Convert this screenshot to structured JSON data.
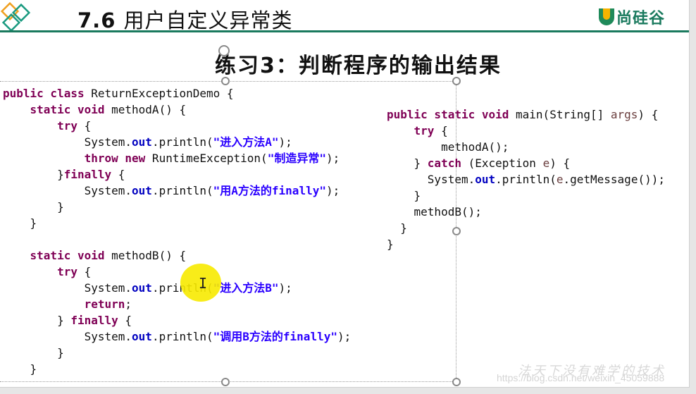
{
  "header": {
    "title_number": "7.6",
    "title_text": "用户自定义异常类",
    "brand": "尚硅谷",
    "accent_color": "#1a7a5e"
  },
  "subtitle": "练习3：判断程序的输出结果",
  "left_code": [
    [
      {
        "t": "public class",
        "c": "kw"
      },
      {
        "t": " ReturnExceptionDemo {",
        "c": ""
      }
    ],
    [
      {
        "t": "    ",
        "c": ""
      },
      {
        "t": "static void",
        "c": "kw"
      },
      {
        "t": " methodA() {",
        "c": ""
      }
    ],
    [
      {
        "t": "        ",
        "c": ""
      },
      {
        "t": "try",
        "c": "kw"
      },
      {
        "t": " {",
        "c": ""
      }
    ],
    [
      {
        "t": "            System.",
        "c": ""
      },
      {
        "t": "out",
        "c": "fld"
      },
      {
        "t": ".println(",
        "c": ""
      },
      {
        "t": "\"进入方法A\"",
        "c": "str"
      },
      {
        "t": ");",
        "c": ""
      }
    ],
    [
      {
        "t": "            ",
        "c": ""
      },
      {
        "t": "throw new",
        "c": "kw"
      },
      {
        "t": " RuntimeException(",
        "c": ""
      },
      {
        "t": "\"制造异常\"",
        "c": "str"
      },
      {
        "t": ");",
        "c": ""
      }
    ],
    [
      {
        "t": "        }",
        "c": ""
      },
      {
        "t": "finally",
        "c": "kw"
      },
      {
        "t": " {",
        "c": ""
      }
    ],
    [
      {
        "t": "            System.",
        "c": ""
      },
      {
        "t": "out",
        "c": "fld"
      },
      {
        "t": ".println(",
        "c": ""
      },
      {
        "t": "\"用A方法的finally\"",
        "c": "str"
      },
      {
        "t": ");",
        "c": ""
      }
    ],
    [
      {
        "t": "        }",
        "c": ""
      }
    ],
    [
      {
        "t": "    }",
        "c": ""
      }
    ],
    [
      {
        "t": "",
        "c": ""
      }
    ],
    [
      {
        "t": "    ",
        "c": ""
      },
      {
        "t": "static void",
        "c": "kw"
      },
      {
        "t": " methodB() {",
        "c": ""
      }
    ],
    [
      {
        "t": "        ",
        "c": ""
      },
      {
        "t": "try",
        "c": "kw"
      },
      {
        "t": " {",
        "c": ""
      }
    ],
    [
      {
        "t": "            System.",
        "c": ""
      },
      {
        "t": "out",
        "c": "fld"
      },
      {
        "t": ".println(",
        "c": ""
      },
      {
        "t": "\"进入方法B\"",
        "c": "str"
      },
      {
        "t": ");",
        "c": ""
      }
    ],
    [
      {
        "t": "            ",
        "c": ""
      },
      {
        "t": "return",
        "c": "kw"
      },
      {
        "t": ";",
        "c": ""
      }
    ],
    [
      {
        "t": "        } ",
        "c": ""
      },
      {
        "t": "finally",
        "c": "kw"
      },
      {
        "t": " {",
        "c": ""
      }
    ],
    [
      {
        "t": "            System.",
        "c": ""
      },
      {
        "t": "out",
        "c": "fld"
      },
      {
        "t": ".println(",
        "c": ""
      },
      {
        "t": "\"调用B方法的finally\"",
        "c": "str"
      },
      {
        "t": ");",
        "c": ""
      }
    ],
    [
      {
        "t": "        }",
        "c": ""
      }
    ],
    [
      {
        "t": "    }",
        "c": ""
      }
    ]
  ],
  "right_code": [
    [
      {
        "t": "public static void",
        "c": "kw"
      },
      {
        "t": " main(String[] ",
        "c": ""
      },
      {
        "t": "args",
        "c": "var"
      },
      {
        "t": ") {",
        "c": ""
      }
    ],
    [
      {
        "t": "    ",
        "c": ""
      },
      {
        "t": "try",
        "c": "kw"
      },
      {
        "t": " {",
        "c": ""
      }
    ],
    [
      {
        "t": "        methodA();",
        "c": ""
      }
    ],
    [
      {
        "t": "    } ",
        "c": ""
      },
      {
        "t": "catch",
        "c": "kw"
      },
      {
        "t": " (Exception ",
        "c": ""
      },
      {
        "t": "e",
        "c": "var"
      },
      {
        "t": ") {",
        "c": ""
      }
    ],
    [
      {
        "t": "      System.",
        "c": ""
      },
      {
        "t": "out",
        "c": "fld"
      },
      {
        "t": ".println(",
        "c": ""
      },
      {
        "t": "e",
        "c": "var"
      },
      {
        "t": ".getMessage());",
        "c": ""
      }
    ],
    [
      {
        "t": "    }",
        "c": ""
      }
    ],
    [
      {
        "t": "    methodB();",
        "c": ""
      }
    ],
    [
      {
        "t": "  }",
        "c": ""
      }
    ],
    [
      {
        "t": "}",
        "c": ""
      }
    ]
  ],
  "cursor_glyph": "I",
  "watermark": {
    "url": "https://blog.csdn.net/weixin_45059888",
    "motto": "法天下没有难学的技术"
  }
}
